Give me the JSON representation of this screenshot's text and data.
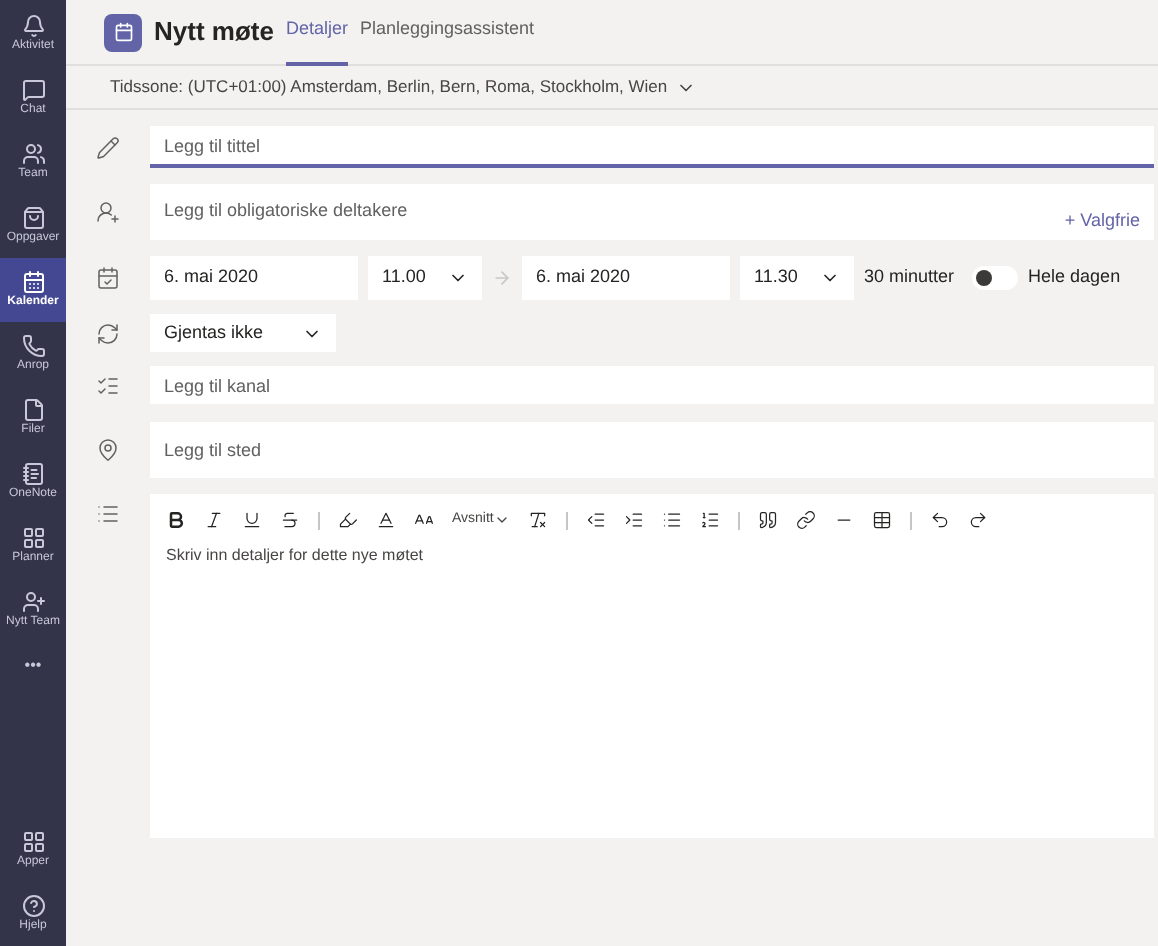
{
  "rail": {
    "items": [
      {
        "kind": "bell",
        "label": "Aktivitet",
        "selected": false
      },
      {
        "kind": "chat",
        "label": "Chat",
        "selected": false
      },
      {
        "kind": "team",
        "label": "Team",
        "selected": false
      },
      {
        "kind": "bag",
        "label": "Oppgaver",
        "selected": false
      },
      {
        "kind": "calendar",
        "label": "Kalender",
        "selected": true
      },
      {
        "kind": "phone",
        "label": "Anrop",
        "selected": false
      },
      {
        "kind": "file",
        "label": "Filer",
        "selected": false
      },
      {
        "kind": "note",
        "label": "OneNote",
        "selected": false
      },
      {
        "kind": "planner",
        "label": "Planner",
        "selected": false
      },
      {
        "kind": "newteam",
        "label": "Nytt Team",
        "selected": false
      }
    ],
    "more": "•••",
    "bottom": [
      {
        "kind": "apps",
        "label": "Apper"
      },
      {
        "kind": "help",
        "label": "Hjelp"
      }
    ]
  },
  "header": {
    "title": "Nytt møte",
    "tabs": [
      {
        "label": "Detaljer",
        "selected": true
      },
      {
        "label": "Planleggingsassistent",
        "selected": false
      }
    ]
  },
  "timezone": "Tidssone: (UTC+01:00) Amsterdam, Berlin, Bern, Roma, Stockholm, Wien",
  "form": {
    "title_placeholder": "Legg til tittel",
    "attendees_placeholder": "Legg til obligatoriske deltakere",
    "optional_link": "+ Valgfrie",
    "start_date": "6. mai 2020",
    "start_time": "11.00",
    "end_date": "6. mai 2020",
    "end_time": "11.30",
    "duration": "30 minutter",
    "all_day": {
      "label": "Hele dagen",
      "on": false
    },
    "recurrence": "Gjentas ikke",
    "channel_placeholder": "Legg til kanal",
    "location_placeholder": "Legg til sted"
  },
  "editor": {
    "paragraph_style": "Avsnitt",
    "placeholder": "Skriv inn detaljer for dette nye møtet"
  }
}
